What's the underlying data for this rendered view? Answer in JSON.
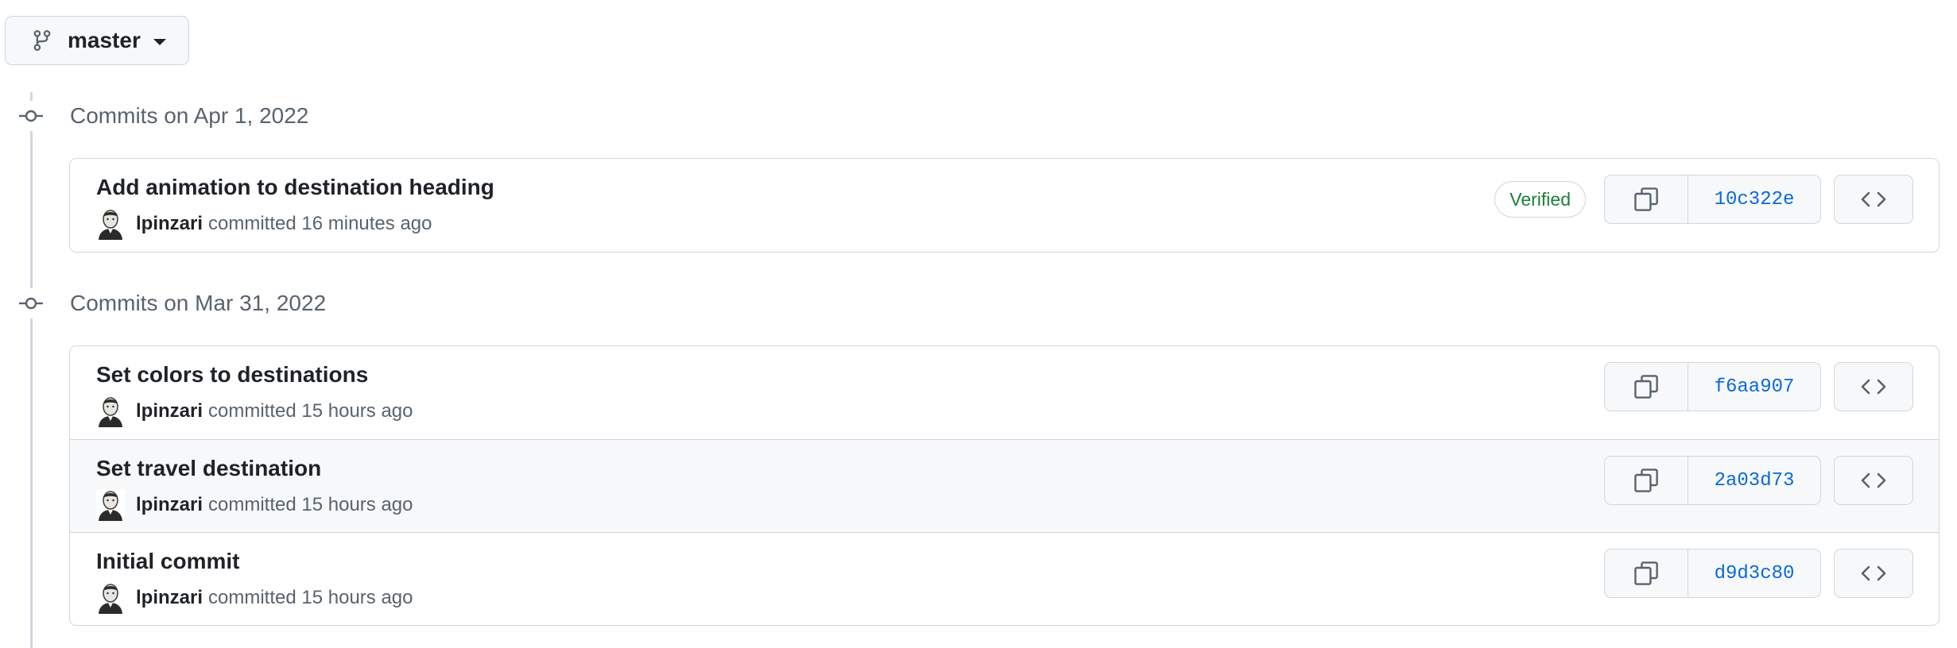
{
  "branch": {
    "icon": "git-branch-icon",
    "name": "master"
  },
  "groups": [
    {
      "header": "Commits on Apr 1, 2022",
      "commits": [
        {
          "title": "Add animation to destination heading",
          "author": "lpinzari",
          "committed_text": "committed 16 minutes ago",
          "verified": "Verified",
          "sha": "10c322e"
        }
      ]
    },
    {
      "header": "Commits on Mar 31, 2022",
      "commits": [
        {
          "title": "Set colors to destinations",
          "author": "lpinzari",
          "committed_text": "committed 15 hours ago",
          "sha": "f6aa907"
        },
        {
          "title": "Set travel destination",
          "author": "lpinzari",
          "committed_text": "committed 15 hours ago",
          "sha": "2a03d73"
        },
        {
          "title": "Initial commit",
          "author": "lpinzari",
          "committed_text": "committed 15 hours ago",
          "sha": "d9d3c80"
        }
      ]
    }
  ],
  "colors": {
    "link": "#0969da",
    "verified": "#1a7f37",
    "border": "#d0d7de",
    "muted_text": "#59636e"
  }
}
